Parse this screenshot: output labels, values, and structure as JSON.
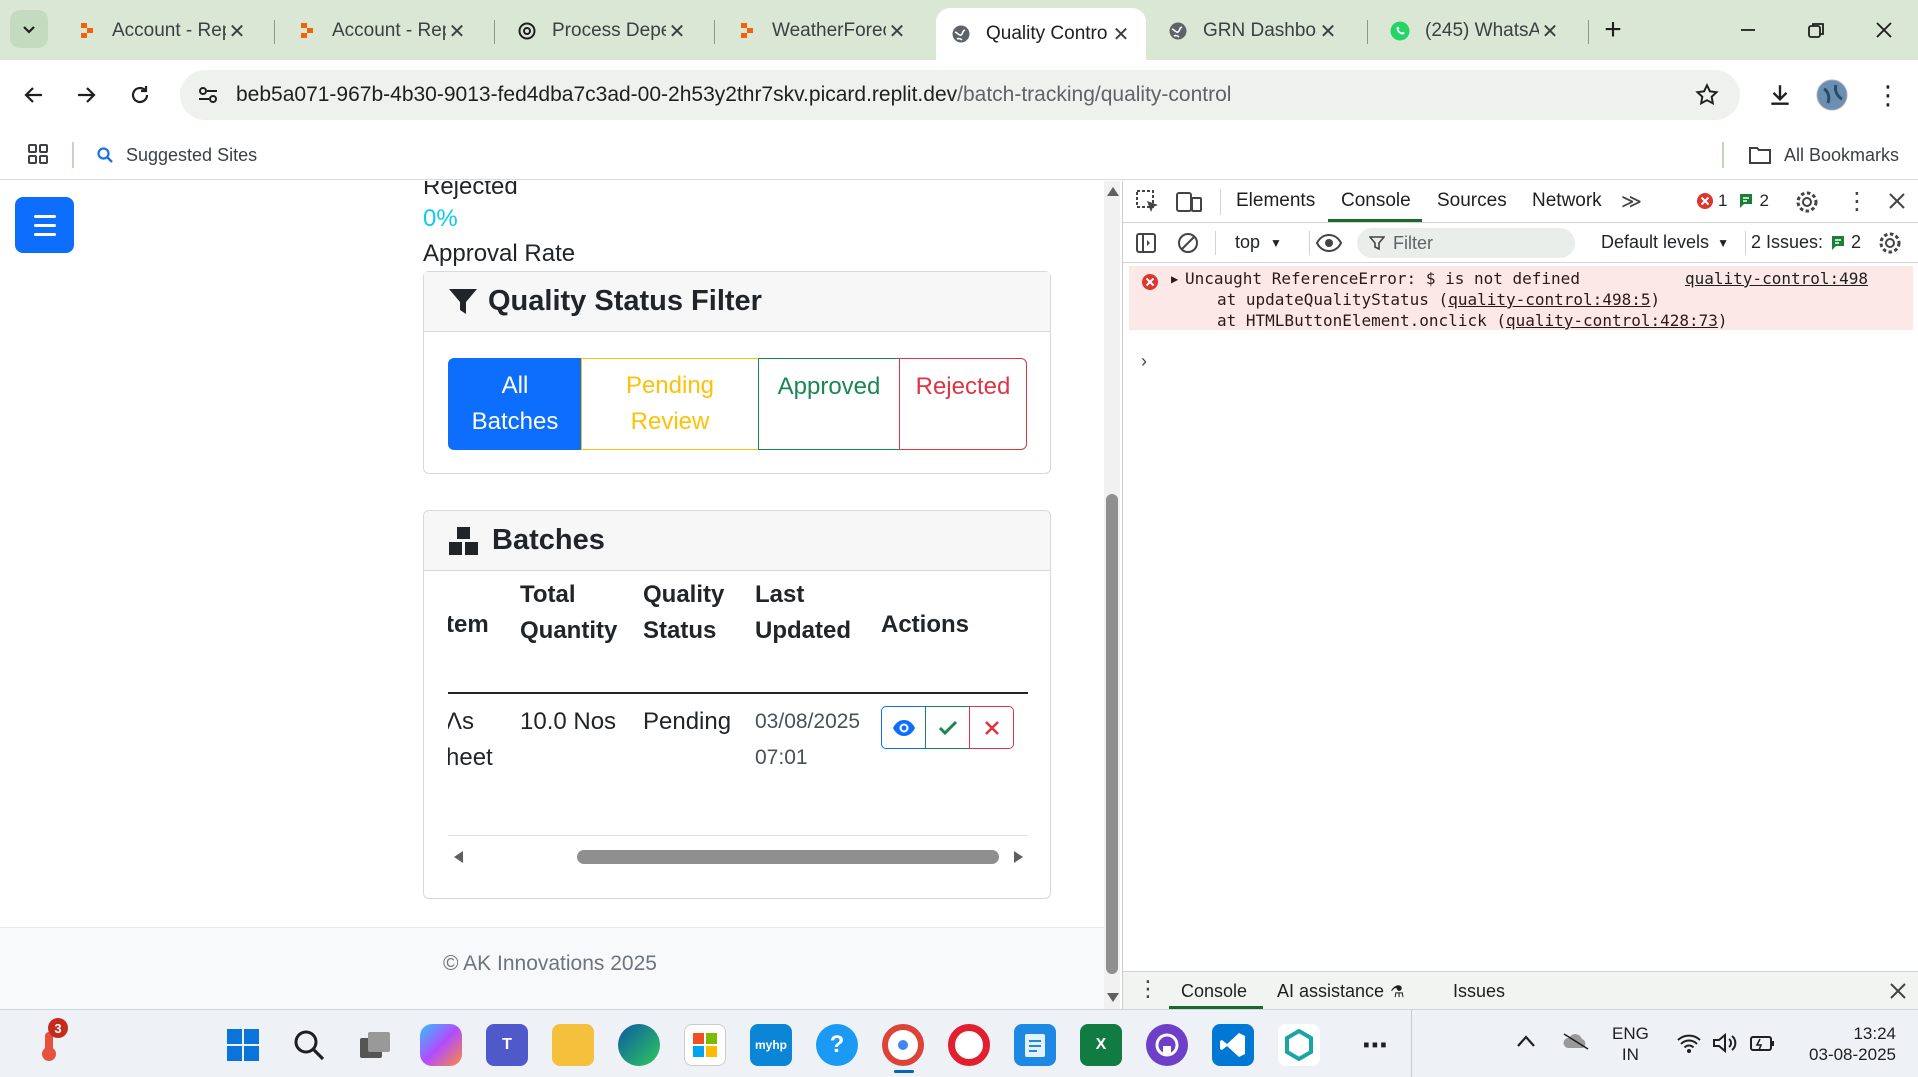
{
  "browser": {
    "tabs": [
      {
        "title": "Account - Rep",
        "icon": "replit-icon",
        "active": false
      },
      {
        "title": "Account - Rep",
        "icon": "replit-icon",
        "active": false
      },
      {
        "title": "Process Deper",
        "icon": "chatgpt-icon",
        "active": false
      },
      {
        "title": "WeatherForec",
        "icon": "replit-icon",
        "active": false
      },
      {
        "title": "Quality Contro",
        "icon": "globe-icon",
        "active": true
      },
      {
        "title": "GRN Dashboa",
        "icon": "globe-icon",
        "active": false
      },
      {
        "title": "(245) WhatsAp",
        "icon": "whatsapp-icon",
        "active": false
      }
    ],
    "url_host": "beb5a071-967b-4b30-9013-fed4dba7c3ad-00-2h53y2thr7skv.picard.replit.dev",
    "url_path": "/batch-tracking/quality-control",
    "bookmarks": {
      "suggested": "Suggested Sites",
      "all": "All Bookmarks"
    }
  },
  "page": {
    "stats_partial_label": "Rejected",
    "stats_value": "0%",
    "stats_label": "Approval Rate",
    "filter_card": {
      "title": "Quality Status Filter",
      "buttons": [
        {
          "label_line1": "All",
          "label_line2": "Batches",
          "color": "#0d6efd",
          "active": true
        },
        {
          "label_line1": "Pending",
          "label_line2": "Review",
          "color": "#ffc107",
          "active": false
        },
        {
          "label_line1": "Approved",
          "label_line2": "",
          "color": "#198754",
          "active": false
        },
        {
          "label_line1": "Rejected",
          "label_line2": "",
          "color": "#dc3545",
          "active": false
        }
      ]
    },
    "batches_card": {
      "title": "Batches",
      "columns": [
        {
          "line1": "",
          "line2": "tem"
        },
        {
          "line1": "Total",
          "line2": "Quantity"
        },
        {
          "line1": "Quality",
          "line2": "Status"
        },
        {
          "line1": "Last",
          "line2": "Updated"
        },
        {
          "line1": "",
          "line2": "Actions"
        }
      ],
      "rows": [
        {
          "item_line1": "Λs",
          "item_line2": "heet",
          "quantity": "10.0 Nos",
          "status": "Pending",
          "date": "03/08/2025",
          "time": "07:01"
        }
      ]
    },
    "footer": "© AK Innovations 2025"
  },
  "devtools": {
    "tabs": [
      "Elements",
      "Console",
      "Sources",
      "Network"
    ],
    "active_tab": "Console",
    "error_count": "1",
    "issue_badge_count": "2",
    "context": "top",
    "filter_placeholder": "Filter",
    "levels": "Default levels",
    "issues_label": "2 Issues:",
    "issues_count": "2",
    "error": {
      "message": "Uncaught ReferenceError: $ is not defined",
      "source": "quality-control:498",
      "stack": [
        {
          "prefix": "at updateQualityStatus (",
          "link": "quality-control:498:5",
          "suffix": ")"
        },
        {
          "prefix": "at HTMLButtonElement.onclick (",
          "link": "quality-control:428:73",
          "suffix": ")"
        }
      ]
    },
    "drawer_tabs": [
      "Console",
      "AI assistance",
      "Issues"
    ]
  },
  "taskbar": {
    "badge_count": "3",
    "language": "ENG",
    "region": "IN",
    "time": "13:24",
    "date": "03-08-2025"
  }
}
